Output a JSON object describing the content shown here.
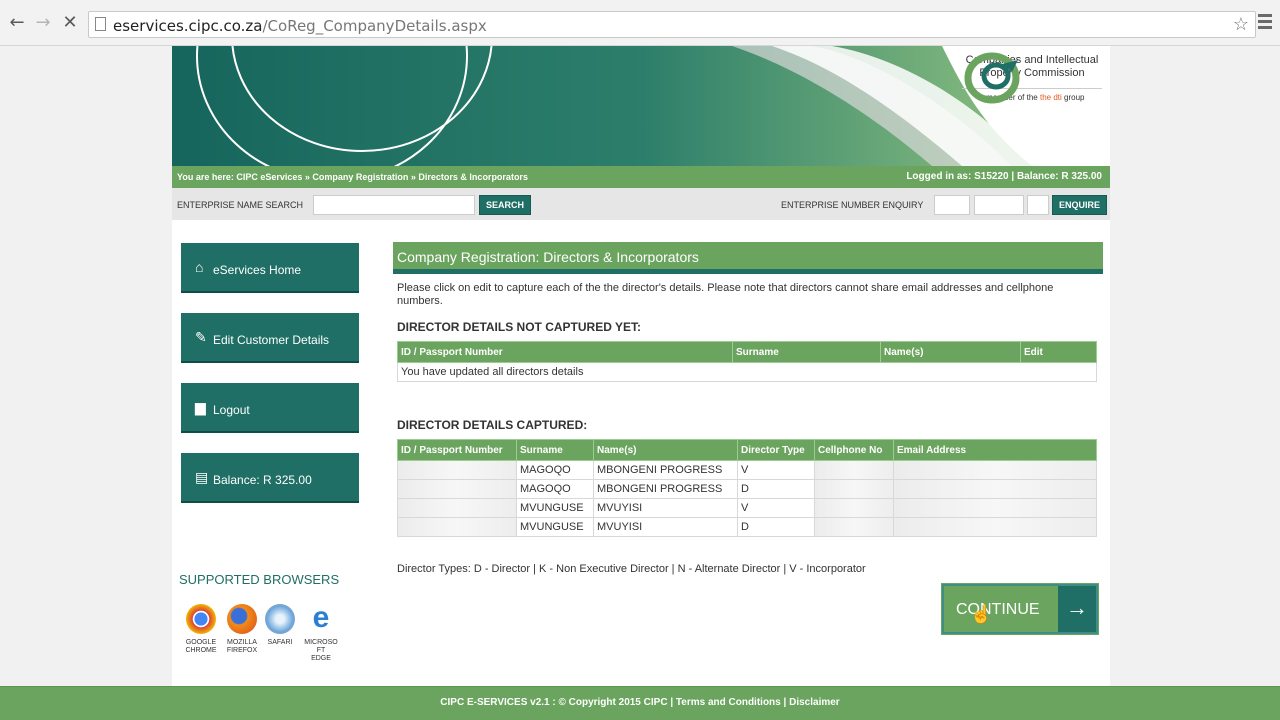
{
  "browser": {
    "url_domain": "eservices.cipc.co.za",
    "url_path": "/CoReg_CompanyDetails.aspx"
  },
  "header": {
    "logo_text_1": "Companies and Intellectual",
    "logo_text_2": "Property Commission",
    "logo_member": "a member of the",
    "logo_dti": "the dti",
    "logo_group": "group",
    "breadcrumb": "You are here: CIPC eServices » Company Registration » Directors & Incorporators",
    "login": "Logged in as: S15220 | Balance: R 325.00"
  },
  "search": {
    "name_label": "ENTERPRISE NAME SEARCH",
    "search_button": "SEARCH",
    "number_label": "ENTERPRISE NUMBER ENQUIRY",
    "enquire_button": "ENQUIRE"
  },
  "sidebar": {
    "items": [
      {
        "label": "eServices Home",
        "icon": "home-icon"
      },
      {
        "label": "Edit Customer Details",
        "icon": "edit-icon"
      },
      {
        "label": "Logout",
        "icon": "lock-icon"
      },
      {
        "label": "Balance: R 325.00",
        "icon": "money-icon"
      }
    ],
    "browsers_title": "SUPPORTED BROWSERS",
    "browsers": [
      {
        "l1": "GOOGLE",
        "l2": "CHROME"
      },
      {
        "l1": "MOZILLA",
        "l2": "FIREFOX"
      },
      {
        "l1": "SAFARI",
        "l2": ""
      },
      {
        "l1": "MICROSO FT",
        "l2": "EDGE"
      }
    ]
  },
  "main": {
    "title": "Company Registration: Directors & Incorporators",
    "intro": "Please click on edit to capture each of the the director's details. Please note that directors cannot share email addresses and cellphone numbers.",
    "not_captured_heading": "DIRECTOR DETAILS NOT CAPTURED YET:",
    "not_captured_headers": [
      "ID / Passport Number",
      "Surname",
      "Name(s)",
      "Edit"
    ],
    "not_captured_message": "You have updated all directors details",
    "captured_heading": "DIRECTOR DETAILS CAPTURED:",
    "captured_headers": [
      "ID / Passport Number",
      "Surname",
      "Name(s)",
      "Director Type",
      "Cellphone No",
      "Email Address"
    ],
    "captured_rows": [
      {
        "surname": "MAGOQO",
        "names": "MBONGENI PROGRESS",
        "type": "V"
      },
      {
        "surname": "MAGOQO",
        "names": "MBONGENI PROGRESS",
        "type": "D"
      },
      {
        "surname": "MVUNGUSE",
        "names": "MVUYISI",
        "type": "V"
      },
      {
        "surname": "MVUNGUSE",
        "names": "MVUYISI",
        "type": "D"
      }
    ],
    "director_types": "Director Types: D - Director | K - Non Executive Director | N - Alternate Director | V - Incorporator",
    "continue_label": "CONTINUE"
  },
  "footer": {
    "copyright": "CIPC E-SERVICES v2.1 : © Copyright 2015 CIPC |",
    "terms": "Terms and Conditions",
    "sep": "|",
    "disclaimer": "Disclaimer"
  },
  "colors": {
    "green": "#6aa45e",
    "teal": "#1f6f66"
  }
}
